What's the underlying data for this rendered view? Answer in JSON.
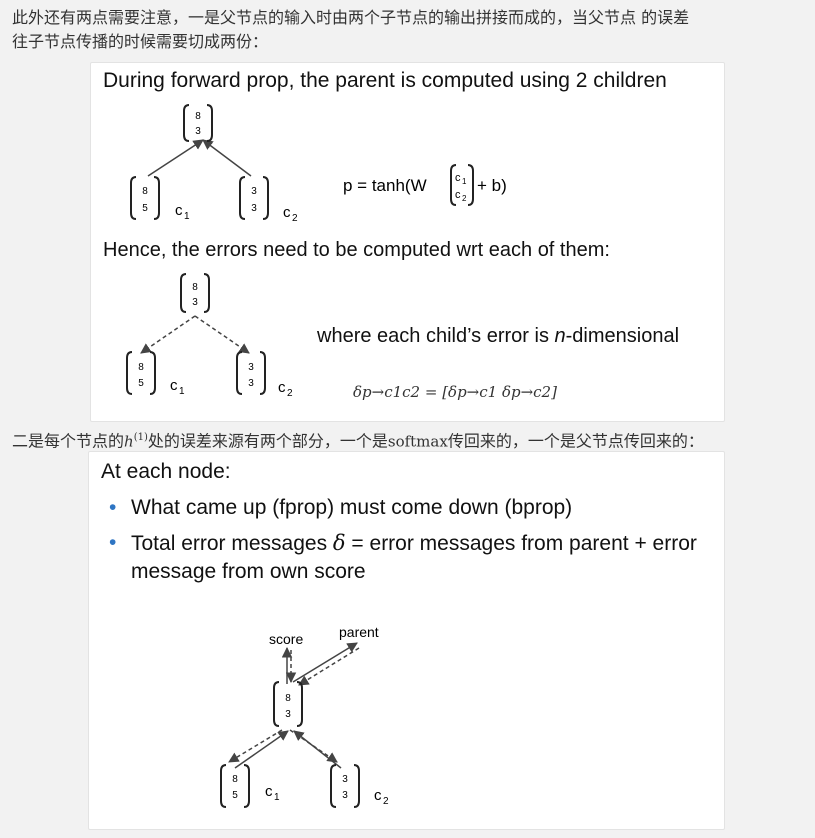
{
  "text": {
    "para1_line1": "此外还有两点需要注意，一是父节点的输入时由两个子节点的输出拼接而成的，当父节点 的误差",
    "para1_line2": "往子节点传播的时候需要切成两份：",
    "para2_pre": "二是每个节点的",
    "para2_var": "h",
    "para2_sup": "(1)",
    "para2_mid": "处的误差来源有两个部分，一个是",
    "para2_softmax": "softmax",
    "para2_post": "传回来的，一个是父节点传回来的："
  },
  "slide1": {
    "title": "During forward prop, the parent is computed using 2 children",
    "parent_vec": [
      "8",
      "3"
    ],
    "child1_vec": [
      "8",
      "5"
    ],
    "child2_vec": [
      "3",
      "3"
    ],
    "child1_label": "c",
    "child1_sub": "1",
    "child2_label": "c",
    "child2_sub": "2",
    "formula_lhs": "p  =  tanh(W",
    "formula_c1": "c",
    "formula_c1_sub": "1",
    "formula_c2": "c",
    "formula_c2_sub": "2",
    "formula_rhs": "+ b)",
    "subtitle": "Hence, the errors need to be computed wrt each of them:",
    "note_pre": "where each child’s error is ",
    "note_italic": "n",
    "note_post": "-dimensional",
    "delta_formula": "δp→c1c2 = [δp→c1 δp→c2]"
  },
  "slide2": {
    "title": "At each node:",
    "bullet1": "What came up (fprop) must come down (bprop)",
    "bullet2_pre": "Total error messages ",
    "bullet2_delta": "δ",
    "bullet2_post": " = error messages from parent + error message from own score",
    "score_label": "score",
    "parent_label": "parent",
    "node_vec": [
      "8",
      "3"
    ],
    "child1_vec": [
      "8",
      "5"
    ],
    "child2_vec": [
      "3",
      "3"
    ],
    "child1_label": "c",
    "child1_sub": "1",
    "child2_label": "c",
    "child2_sub": "2"
  },
  "colors": {
    "bullet": "#2e75c3",
    "background": "#f2f2f2"
  }
}
